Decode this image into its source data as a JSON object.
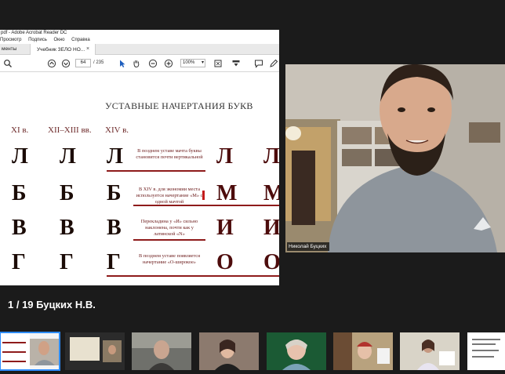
{
  "acrobat": {
    "title": "pdf - Adobe Acrobat Reader DC",
    "menu": [
      "Просмотр",
      "Подпись",
      "Окно",
      "Справка"
    ],
    "tab_left": "менты",
    "tab_active": "Учебник ЗЕЛО НО...",
    "tab_close": "×",
    "page_current": "64",
    "page_total": "/ 235",
    "zoom": "100%"
  },
  "document": {
    "title": "УСТАВНЫЕ НАЧЕРТАНИЯ БУКВ",
    "col_headers": [
      "XI в.",
      "XII–XIII вв.",
      "XIV в."
    ],
    "rows": [
      {
        "glyphs": [
          "Л",
          "Л",
          "Л"
        ],
        "extra": [
          "Л",
          "Л"
        ],
        "note": "В позднем уставе мачта буквы становится почти вертикальной"
      },
      {
        "glyphs": [
          "Б",
          "Б",
          "Б"
        ],
        "extra": [
          "М",
          "М"
        ],
        "note": "В XIV в. для экономии места используется начертание «М» с одной мачтой"
      },
      {
        "glyphs": [
          "В",
          "В",
          "В"
        ],
        "extra": [
          "И",
          "И"
        ],
        "note": "Перекладина у «И» сильно наклонена, почти как у латинской «N»"
      },
      {
        "glyphs": [
          "Г",
          "Г",
          "Г"
        ],
        "extra": [
          "О",
          "О"
        ],
        "note": "В позднем уставе появляется начертание «О-широкое»"
      }
    ]
  },
  "camera": {
    "participant_name": "Николай Буцких"
  },
  "gallery": {
    "label": "1 / 19  Буцких Н.В.",
    "thumbnails": [
      "thumb-1",
      "thumb-2",
      "thumb-3",
      "thumb-4",
      "thumb-5",
      "thumb-6",
      "thumb-7",
      "thumb-8"
    ]
  },
  "colors": {
    "accent": "#2d8cff",
    "note_text": "#6b1a1a",
    "note_line": "#8e1b1b",
    "glyph": "#1b0b06"
  }
}
